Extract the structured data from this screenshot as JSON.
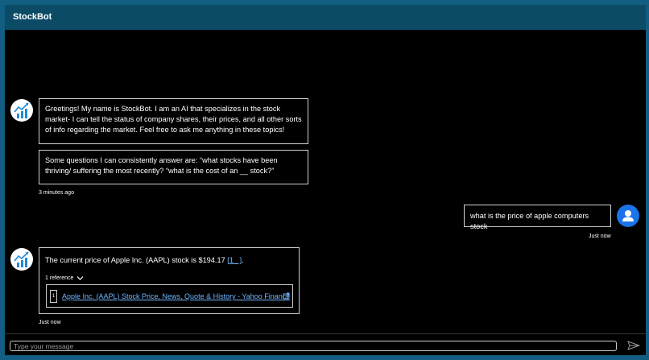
{
  "header": {
    "title": "StockBot"
  },
  "messages": {
    "bot_intro": {
      "bubble1": "Greetings! My name is StockBot. I am an AI that specializes in the stock market- I can tell the status of company shares, their prices, and all other sorts of info regarding the market. Feel free to ask me anything in these topics!",
      "bubble2": "Some questions I can consistently answer are: “what stocks have been thriving/ suffering the most recently? “what is the cost of an __ stock?”",
      "timestamp": "3 minutes ago"
    },
    "user": {
      "text": "what is the price of apple computers stock",
      "timestamp": "Just now"
    },
    "bot_answer": {
      "text": "The current price of Apple Inc. (AAPL) stock is $194.17",
      "citation": "1",
      "reference_toggle": "1 reference",
      "reference_num": "1",
      "reference_title": "Apple Inc. (AAPL) Stock Price, News, Quote & History - Yahoo Finance",
      "timestamp": "Just now"
    }
  },
  "composer": {
    "placeholder": "Type your message"
  },
  "icons": {
    "bot_avatar": "stock-chart-icon",
    "user_avatar": "person-icon",
    "send": "send-icon",
    "external": "external-link-icon",
    "chevron": "chevron-down-icon"
  },
  "colors": {
    "header_bg": "#0c4b66",
    "frame_bg": "#115e82",
    "chat_bg": "#000000",
    "user_avatar": "#1a73e8",
    "link": "#6fb6ff"
  }
}
